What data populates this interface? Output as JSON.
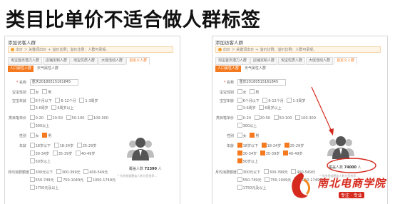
{
  "page_title": "类目比单价不适合做人群标签",
  "panels": [
    {
      "title": "添加访客人群",
      "notice": "出价 ＞ 关键词出价 ＋ 溢价比例；溢价比例：人群可承受。",
      "tabs": [
        "淘宝首页潜力人群",
        "店铺定制人群",
        "淘宝优质人群",
        "大促活动人群",
        "自定义人群"
      ],
      "active_tab": 4,
      "subtabs": [
        "人口属性人群",
        "天气属性人群"
      ],
      "name_label": "名称",
      "name_value": "重庆20180515161845",
      "gender_label": "宝宝性别",
      "gender_options": [
        "女",
        "男"
      ],
      "baby_age_label": "宝宝年龄",
      "baby_age_options": [
        "6个月以下",
        "6-12个月",
        "1-3周岁",
        "3-6周岁",
        "6周岁以上"
      ],
      "price_label": "类目笔单价",
      "price_options": [
        "0-20",
        "20-50",
        "50-100",
        "100-300",
        "300以上"
      ],
      "sex_label": "性别",
      "sex_options": [
        "女",
        "男"
      ],
      "age_label": "年龄",
      "age_options": [
        "18岁以下",
        "18-24岁",
        "25-29岁",
        "30-34岁",
        "35-39岁",
        "40-49岁",
        "50岁以上"
      ],
      "spend_label": "月均消费额度",
      "spend_options": [
        "300元以下",
        "300-399元",
        "400-549元",
        "550-749元",
        "750-1049元",
        "1050-1749元",
        "1750元及以上"
      ],
      "covered_label": "覆盖人数",
      "covered_value": "72390",
      "covered_unit": "人",
      "hint": "* 系统根据覆盖人数为您推荐..."
    },
    {
      "title": "添加访客人群",
      "notice": "出价 ＞ 关键词出价 ＋ 溢价比例；溢价比例：人群可承受。",
      "tabs": [
        "淘宝首页潜力人群",
        "店铺定制人群",
        "淘宝优质人群",
        "大促活动人群",
        "自定义人群"
      ],
      "active_tab": 4,
      "subtabs": [
        "人口属性人群",
        "天气属性人群"
      ],
      "name_label": "名称",
      "name_value": "重庆20180515161845",
      "gender_label": "宝宝性别",
      "gender_options": [
        "女",
        "男"
      ],
      "baby_age_label": "宝宝年龄",
      "baby_age_options": [
        "6个月以下",
        "6-12个月",
        "1-3周岁",
        "3-6周岁",
        "6周岁以上"
      ],
      "price_label": "类目笔单价",
      "price_options": [
        "0-20",
        "20-50",
        "50-100",
        "100-300",
        "300以上"
      ],
      "sex_label": "性别",
      "sex_options": [
        "女",
        "男"
      ],
      "age_label": "年龄",
      "age_options": [
        "18岁以下",
        "18-24岁",
        "25-29岁",
        "30-34岁",
        "35-39岁",
        "40-49岁",
        "50岁以上"
      ],
      "spend_label": "月均消费额度",
      "spend_options": [
        "300元以下",
        "300-399元",
        "400-549元",
        "550-749元",
        "750-1049元",
        "1050-1749元",
        "1750元及以上"
      ],
      "covered_label": "覆盖人数",
      "covered_value": "74000",
      "covered_unit": "人",
      "hint": "* 系统根据覆盖人数为您推荐..."
    }
  ],
  "watermark": {
    "brand": "南北电商学院",
    "slogan": "专注 · 专业"
  },
  "colors": {
    "accent": "#f57a1f",
    "annotation": "#d62a1e"
  }
}
